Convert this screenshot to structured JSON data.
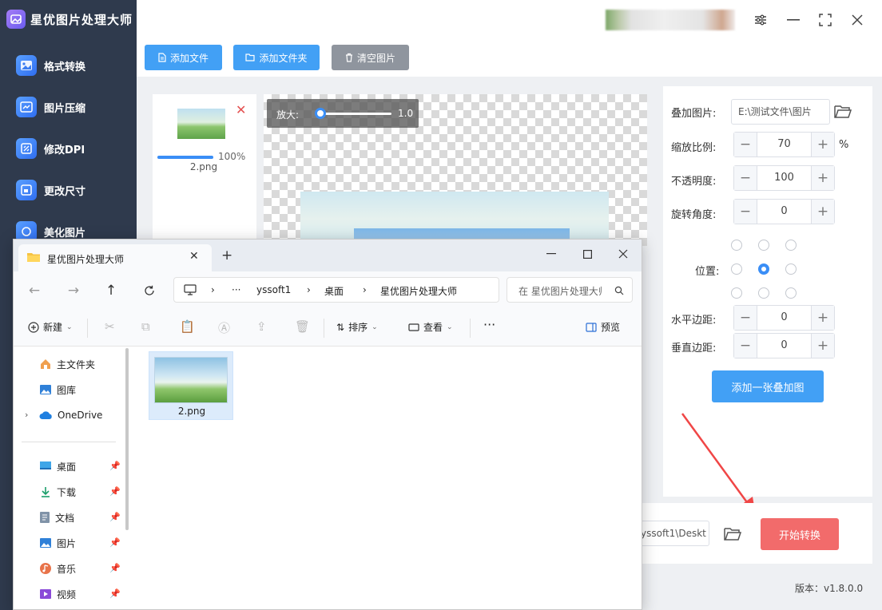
{
  "app": {
    "title": "星优图片处理大师",
    "version_text": "版本：v1.8.0.0",
    "accent_color": "#3a8ef6",
    "danger_color": "#f26b6b"
  },
  "sidebar": {
    "items": [
      {
        "label": "格式转换",
        "icon": "image-convert-icon"
      },
      {
        "label": "图片压缩",
        "icon": "image-compress-icon"
      },
      {
        "label": "修改DPI",
        "icon": "dpi-icon"
      },
      {
        "label": "更改尺寸",
        "icon": "resize-icon"
      },
      {
        "label": "美化图片",
        "icon": "beautify-icon"
      }
    ]
  },
  "toolbar": {
    "add_file": "添加文件",
    "add_folder": "添加文件夹",
    "clear": "清空图片"
  },
  "file_list": {
    "items": [
      {
        "name": "2.png",
        "progress_text": "100%",
        "progress": 1.0
      }
    ]
  },
  "preview": {
    "zoom_label": "放大:",
    "zoom_value": "1.0"
  },
  "settings": {
    "overlay_label": "叠加图片:",
    "overlay_path": "E:\\测试文件\\图片",
    "scale_label": "缩放比例:",
    "scale_value": "70",
    "scale_unit": "%",
    "opacity_label": "不透明度:",
    "opacity_value": "100",
    "rotate_label": "旋转角度:",
    "rotate_value": "0",
    "position_label": "位置:",
    "position_selected": "middle-center",
    "hmargin_label": "水平边距:",
    "hmargin_value": "0",
    "vmargin_label": "垂直边距:",
    "vmargin_value": "0",
    "add_overlay_button": "添加一张叠加图"
  },
  "output": {
    "path": "yssoft1\\Deskt",
    "start_button": "开始转换"
  },
  "explorer": {
    "tab_title": "星优图片处理大师",
    "breadcrumb": [
      "yssoft1",
      "桌面",
      "星优图片处理大师"
    ],
    "search_placeholder": "在 星优图片处理大师 中搜索",
    "commands": {
      "new": "新建",
      "sort": "排序",
      "view": "查看",
      "preview": "预览"
    },
    "nav": {
      "home": "主文件夹",
      "gallery": "图库",
      "onedrive": "OneDrive",
      "quick_access": [
        {
          "label": "桌面",
          "icon": "desktop-icon"
        },
        {
          "label": "下载",
          "icon": "download-icon"
        },
        {
          "label": "文档",
          "icon": "document-icon"
        },
        {
          "label": "图片",
          "icon": "picture-icon"
        },
        {
          "label": "音乐",
          "icon": "music-icon"
        },
        {
          "label": "视频",
          "icon": "video-icon"
        }
      ]
    },
    "files": [
      {
        "name": "2.png"
      }
    ]
  }
}
